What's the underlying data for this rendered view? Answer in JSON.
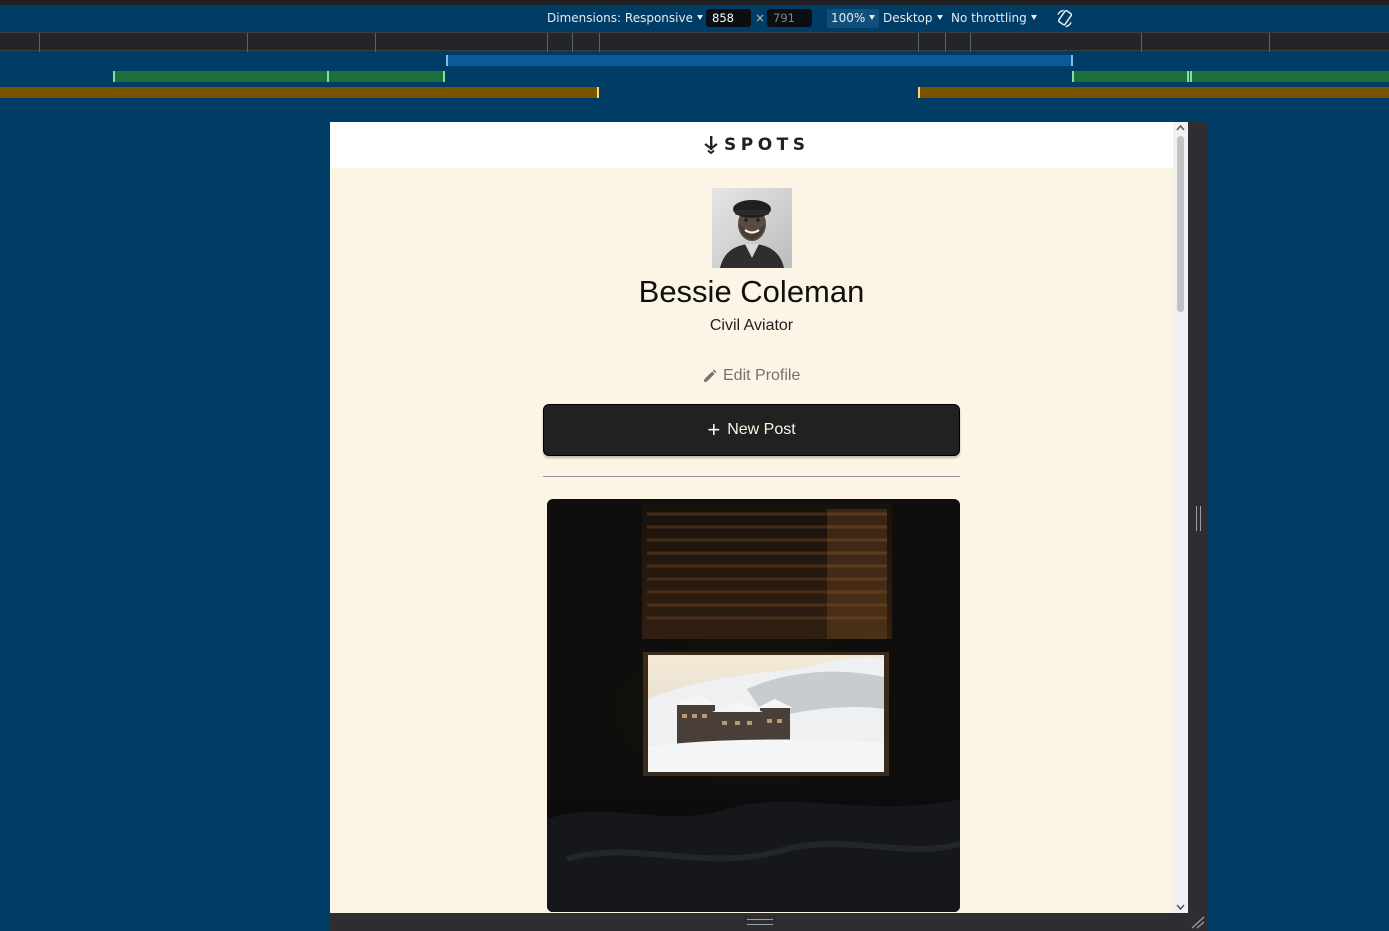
{
  "devtools": {
    "dimensions_label": "Dimensions: Responsive",
    "width_value": "858",
    "height_placeholder": "791",
    "times_sign": "×",
    "zoom": "100%",
    "device_type": "Desktop",
    "throttling": "No throttling"
  },
  "page": {
    "logo_text": "SPOTS",
    "profile": {
      "name": "Bessie Coleman",
      "description": "Civil Aviator"
    },
    "edit_profile_label": "Edit Profile",
    "new_post_label": "New Post",
    "new_post_icon": "+"
  },
  "colors": {
    "devtools_background": "#003d66",
    "page_background": "#fcf5e5",
    "button_background": "#212121",
    "button_text": "#fcf5e5"
  },
  "icons": [
    "plane-logo-icon",
    "pencil-icon",
    "plus-icon",
    "rotate-icon",
    "caret-down-icon"
  ]
}
